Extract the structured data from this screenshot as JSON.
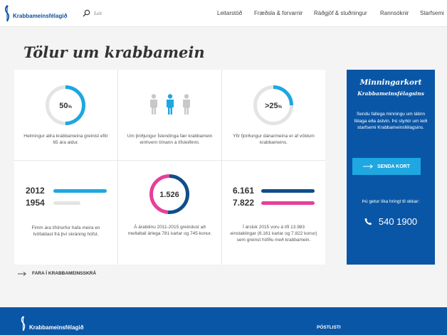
{
  "header": {
    "logo_text": "Krabbameinsfélagið",
    "search_placeholder": "Leit",
    "nav": [
      "Leitarstöð",
      "Fræðsla & forvarnir",
      "Ráðgjöf & stuðningur",
      "Rannsóknir",
      "Starfsemi"
    ]
  },
  "page_title": "Tölur um krabbamein",
  "stats": {
    "s1": {
      "value": "50",
      "unit": "%",
      "fraction": 0.5,
      "caption": "Helmingur allra krabbameina greinist eftir 65 ára aldur."
    },
    "s2": {
      "caption": "Um þriðjungur Íslendinga fær krabbamein einhvern tímann á lífsleiðinni.",
      "highlighted_figure": 2,
      "figure_count": 3
    },
    "s3": {
      "value": ">25",
      "unit": "%",
      "fraction": 0.25,
      "caption": "Yfir fjórðungur dánarmeina er af völdum krabbameins."
    },
    "s4": {
      "rows": [
        {
          "year": "2012",
          "fraction": 1.0
        },
        {
          "year": "1954",
          "fraction": 0.0
        }
      ],
      "caption": "Fimm ára lífshorfur hafa meira en tvöfaldast frá því skráning hófst."
    },
    "s5": {
      "value": "1.526",
      "men": 781,
      "women": 745,
      "caption": "Á árabilinu 2011-2015 greindust að meðaltali árlega 781 karlar og 745 konur."
    },
    "s6": {
      "rows": [
        {
          "value": "6.161"
        },
        {
          "value": "7.822"
        }
      ],
      "caption": "Í árslok 2015 voru á lífi 13.983 einstaklingar (6.161 karlar og 7.822 konur) sem greinst höfðu með krabbamein."
    }
  },
  "card": {
    "title": "Minningarkort",
    "subtitle": "Krabbameinsfélagsins",
    "text": "Sendu fallega minningu um látinn félaga eða ástvin. Þú styrkir um leið starfsemi Krabbameinsfélagsins.",
    "button_label": "SENDA KORT",
    "ask": "Þú getur líka hringt til okkar:",
    "phone": "540 1900"
  },
  "registry_link": "FARA Í KRABBAMEINSSKRÁ",
  "footer": {
    "logo_text": "Krabbameinsfélagið",
    "postlisti": "PÓSTLISTI"
  },
  "colors": {
    "brand_blue": "#0a56a6",
    "light_blue": "#1ea7e1",
    "pink": "#e63f9a",
    "dark_blue": "#104d8b",
    "ring_grey": "#e4e4e4",
    "figure_grey": "#c8c8c8"
  },
  "icons": [
    "ribbon-logo-icon",
    "search-icon",
    "person-icon",
    "arrow-right-icon",
    "phone-icon"
  ]
}
